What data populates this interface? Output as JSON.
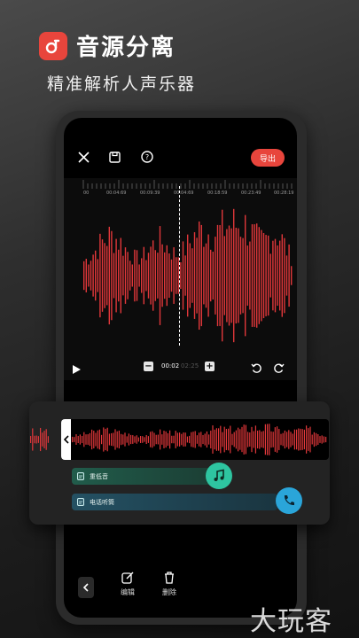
{
  "header": {
    "title": "音源分离",
    "subtitle": "精准解析人声乐器"
  },
  "toolbar": {
    "export_label": "导出"
  },
  "ruler": {
    "ticks": [
      "00",
      "00:04:69",
      "00:09:39",
      "00:04:69",
      "00:18:59",
      "00:23:49",
      "00:28:19"
    ]
  },
  "player": {
    "current_time": "00:02",
    "total_time": "02:25"
  },
  "tracks": [
    {
      "label": "重低音",
      "color": "#2ec4a0",
      "icon": "music-note-icon"
    },
    {
      "label": "电话听筒",
      "color": "#2aa5d9",
      "icon": "phone-icon"
    }
  ],
  "bottom_bar": {
    "edit_label": "编辑",
    "delete_label": "删除"
  },
  "watermark": "大玩客",
  "colors": {
    "accent": "#e8453c",
    "wave": "#e0373a"
  }
}
